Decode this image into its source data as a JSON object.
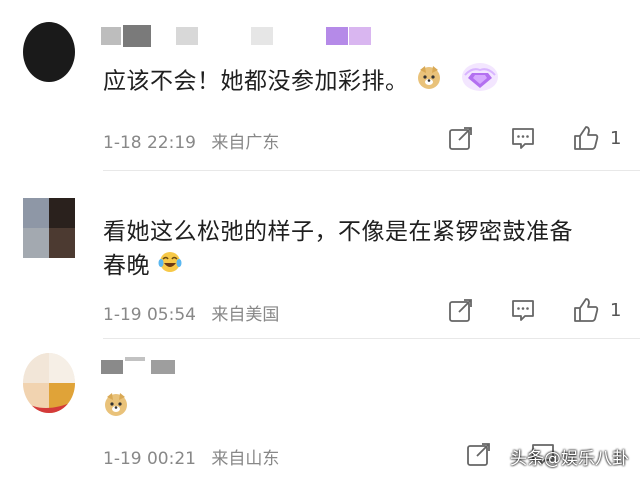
{
  "comments": [
    {
      "text": "应该不会！她都没参加彩排。",
      "time": "1-18 22:19",
      "location": "来自广东",
      "likes": "1"
    },
    {
      "text_line1": "看她这么松弛的样子，不像是在紧锣密鼓准备",
      "text_line2": "春晚",
      "time": "1-19 05:54",
      "location": "来自美国",
      "likes": "1"
    },
    {
      "time": "1-19 00:21",
      "location": "来自山东"
    }
  ],
  "watermark": "头条@娱乐八卦",
  "icons": [
    "share-icon",
    "comment-icon",
    "like-icon",
    "doge-emoji",
    "vip-badge-icon",
    "laugh-cry-emoji"
  ]
}
